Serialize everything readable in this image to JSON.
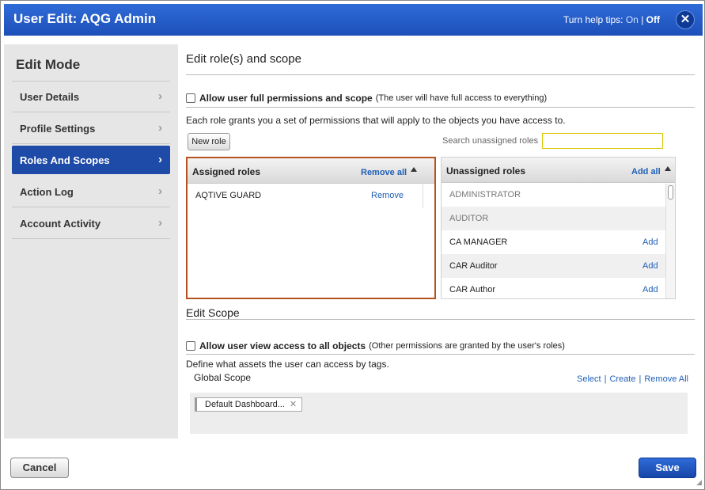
{
  "header": {
    "title": "User Edit:  AQG Admin",
    "help_tips_label": "Turn help tips:",
    "help_on": "On",
    "help_sep": "|",
    "help_off": "Off",
    "close_glyph": "✕"
  },
  "sidebar": {
    "mode_title": "Edit Mode",
    "items": [
      {
        "label": "User Details"
      },
      {
        "label": "Profile Settings"
      },
      {
        "label": "Roles And Scopes"
      },
      {
        "label": "Action Log"
      },
      {
        "label": "Account Activity"
      }
    ],
    "active_index": 2
  },
  "roles": {
    "section_title": "Edit role(s) and scope",
    "full_perm_label": "Allow user full permissions and scope",
    "full_perm_note": "(The user will have full access to everything)",
    "description": "Each role grants you a set of permissions that will apply to the objects you have access to.",
    "new_role_button": "New role",
    "search_label": "Search unassigned roles",
    "search_value": "",
    "assigned_title": "Assigned roles",
    "remove_all": "Remove all",
    "assigned_items": [
      {
        "name": "AQTIVE GUARD",
        "action": "Remove"
      }
    ],
    "unassigned_title": "Unassigned roles",
    "add_all": "Add all",
    "unassigned_items": [
      {
        "name": "ADMINISTRATOR",
        "action": ""
      },
      {
        "name": "AUDITOR",
        "action": ""
      },
      {
        "name": "CA MANAGER",
        "action": "Add"
      },
      {
        "name": "CAR Auditor",
        "action": "Add"
      },
      {
        "name": "CAR Author",
        "action": "Add"
      }
    ]
  },
  "scope": {
    "section_title": "Edit Scope",
    "view_all_label": "Allow user view access to all objects",
    "view_all_note": "(Other permissions are granted by the user's roles)",
    "description": "Define what assets the user can access by tags.",
    "global_label": "Global Scope",
    "select_link": "Select",
    "create_link": "Create",
    "remove_all_link": "Remove All",
    "tags": [
      "Default Dashboard..."
    ]
  },
  "footer": {
    "cancel_label": "Cancel",
    "save_label": "Save"
  },
  "colors": {
    "header_blue": "#1d4fb8",
    "active_nav": "#1e4aa8",
    "link_blue": "#1f5fb8",
    "assigned_border": "#b4531f"
  }
}
